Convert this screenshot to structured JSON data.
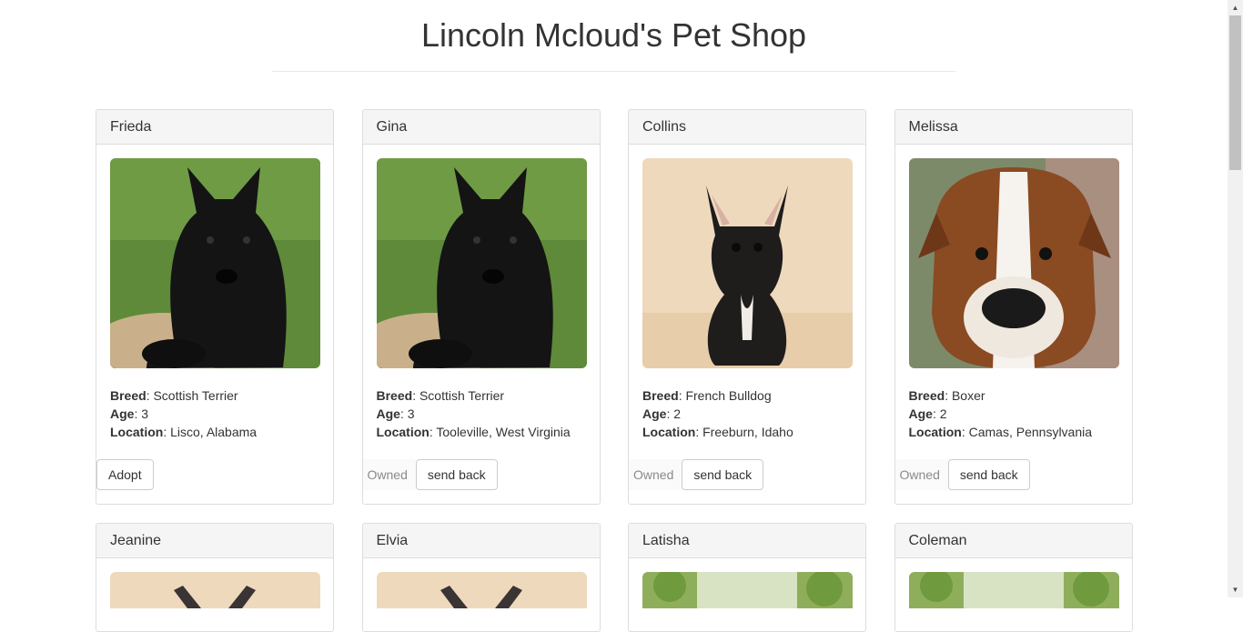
{
  "page": {
    "title": "Lincoln Mcloud's Pet Shop"
  },
  "labels": {
    "breed": "Breed",
    "age": "Age",
    "location": "Location"
  },
  "buttons": {
    "adopt": "Adopt",
    "owned": "Owned",
    "send_back": "send back"
  },
  "pets": [
    {
      "name": "Frieda",
      "breed": "Scottish Terrier",
      "age": "3",
      "location": "Lisco, Alabama",
      "status": "available",
      "image": "scottish-terrier-photo"
    },
    {
      "name": "Gina",
      "breed": "Scottish Terrier",
      "age": "3",
      "location": "Tooleville, West Virginia",
      "status": "owned",
      "image": "scottish-terrier-photo"
    },
    {
      "name": "Collins",
      "breed": "French Bulldog",
      "age": "2",
      "location": "Freeburn, Idaho",
      "status": "owned",
      "image": "french-bulldog-photo"
    },
    {
      "name": "Melissa",
      "breed": "Boxer",
      "age": "2",
      "location": "Camas, Pennsylvania",
      "status": "owned",
      "image": "boxer-photo"
    }
  ],
  "pets_row2": [
    {
      "name": "Jeanine",
      "image": "french-bulldog-photo"
    },
    {
      "name": "Elvia",
      "image": "french-bulldog-photo"
    },
    {
      "name": "Latisha",
      "image": "outdoor-dog-photo"
    },
    {
      "name": "Coleman",
      "image": "outdoor-dog-photo"
    }
  ],
  "colors": {
    "panel_heading_bg": "#f5f5f5",
    "border": "#dddddd",
    "owned_text": "#8a8a8a"
  }
}
